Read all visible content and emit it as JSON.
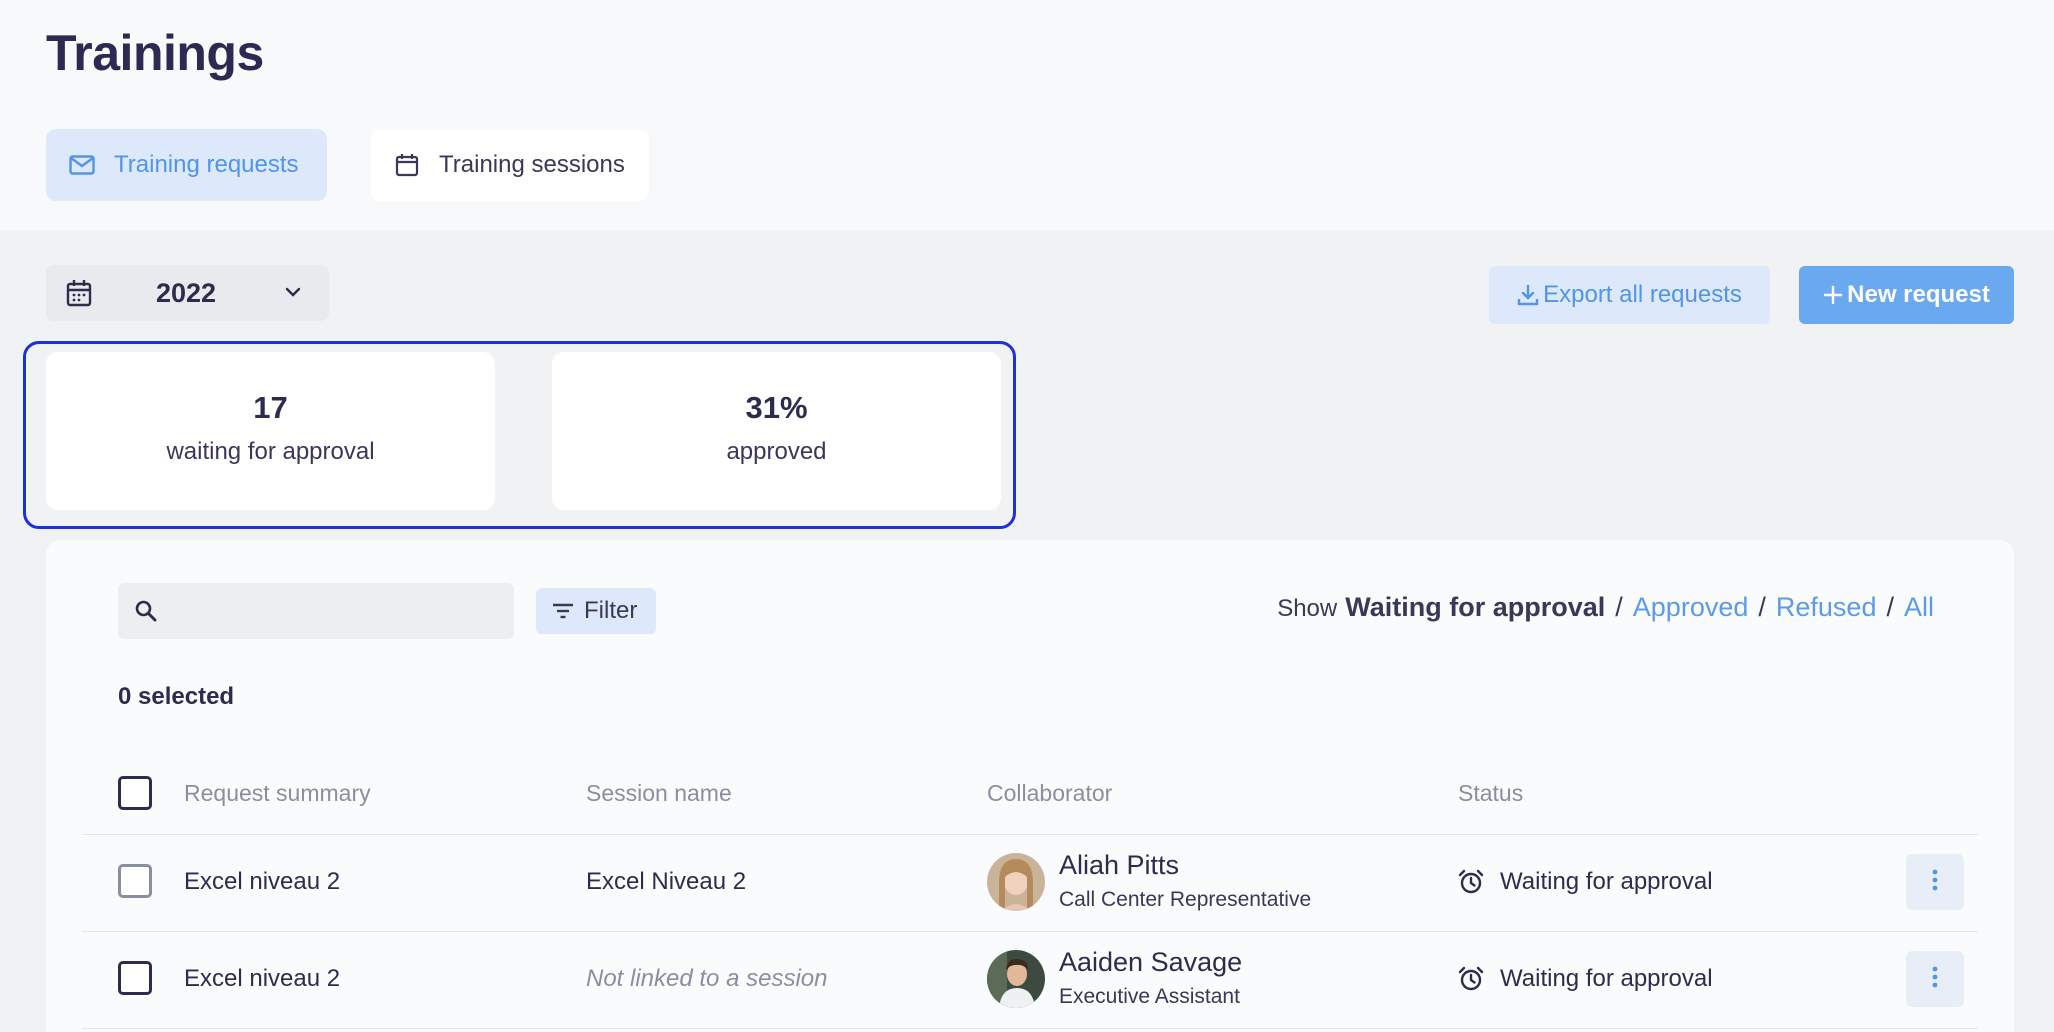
{
  "page": {
    "title": "Trainings"
  },
  "tabs": [
    {
      "label": "Training requests",
      "icon": "mail-icon",
      "active": true
    },
    {
      "label": "Training sessions",
      "icon": "calendar-icon",
      "active": false
    }
  ],
  "year_select": {
    "value": "2022"
  },
  "actions": {
    "export_label": "Export all requests",
    "new_label": "New request"
  },
  "stats": [
    {
      "value": "17",
      "label": "waiting for approval"
    },
    {
      "value": "31%",
      "label": "approved"
    }
  ],
  "toolbar": {
    "search_placeholder": "",
    "filter_label": "Filter",
    "show_label": "Show",
    "show_current": "Waiting for approval",
    "show_options": [
      "Approved",
      "Refused",
      "All"
    ],
    "separator": "/"
  },
  "selection": {
    "count_text": "0 selected"
  },
  "table": {
    "columns": [
      "Request summary",
      "Session name",
      "Collaborator",
      "Status"
    ],
    "rows": [
      {
        "summary": "Excel niveau 2",
        "session": "Excel Niveau 2",
        "session_linked": true,
        "collaborator": "Aliah Pitts",
        "role": "Call Center Representative",
        "status": "Waiting for approval"
      },
      {
        "summary": "Excel niveau 2",
        "session": "Not linked to a session",
        "session_linked": false,
        "collaborator": "Aaiden Savage",
        "role": "Executive Assistant",
        "status": "Waiting for approval"
      }
    ]
  },
  "colors": {
    "accent": "#4f95e8",
    "accent_bg": "#dde9fb",
    "primary_button": "#6aa9f0",
    "highlight_outline": "#1c31d6"
  }
}
